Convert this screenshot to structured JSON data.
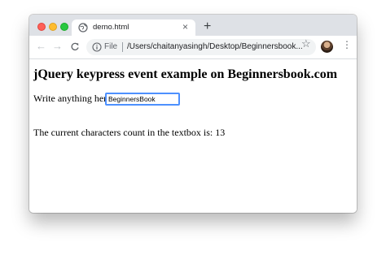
{
  "browser": {
    "tab": {
      "title": "demo.html",
      "close": "×"
    },
    "new_tab": "+",
    "toolbar": {
      "back": "←",
      "forward": "→",
      "reload": "C",
      "scheme_label": "File",
      "url": "/Users/chaitanyasingh/Desktop/Beginnersbook...",
      "star": "☆",
      "menu": "⋮"
    }
  },
  "page": {
    "heading": "jQuery keypress event example on Beginnersbook.com",
    "input_label": "Write anything here:",
    "input_value": "BeginnersBook",
    "count_text": "The current characters count in the textbox is: 13"
  },
  "colors": {
    "tab_strip": "#dee1e6",
    "focus_ring": "#4d90fe",
    "close_light": "#ff5f57",
    "minimize_light": "#febc2e",
    "zoom_light": "#28c840"
  }
}
